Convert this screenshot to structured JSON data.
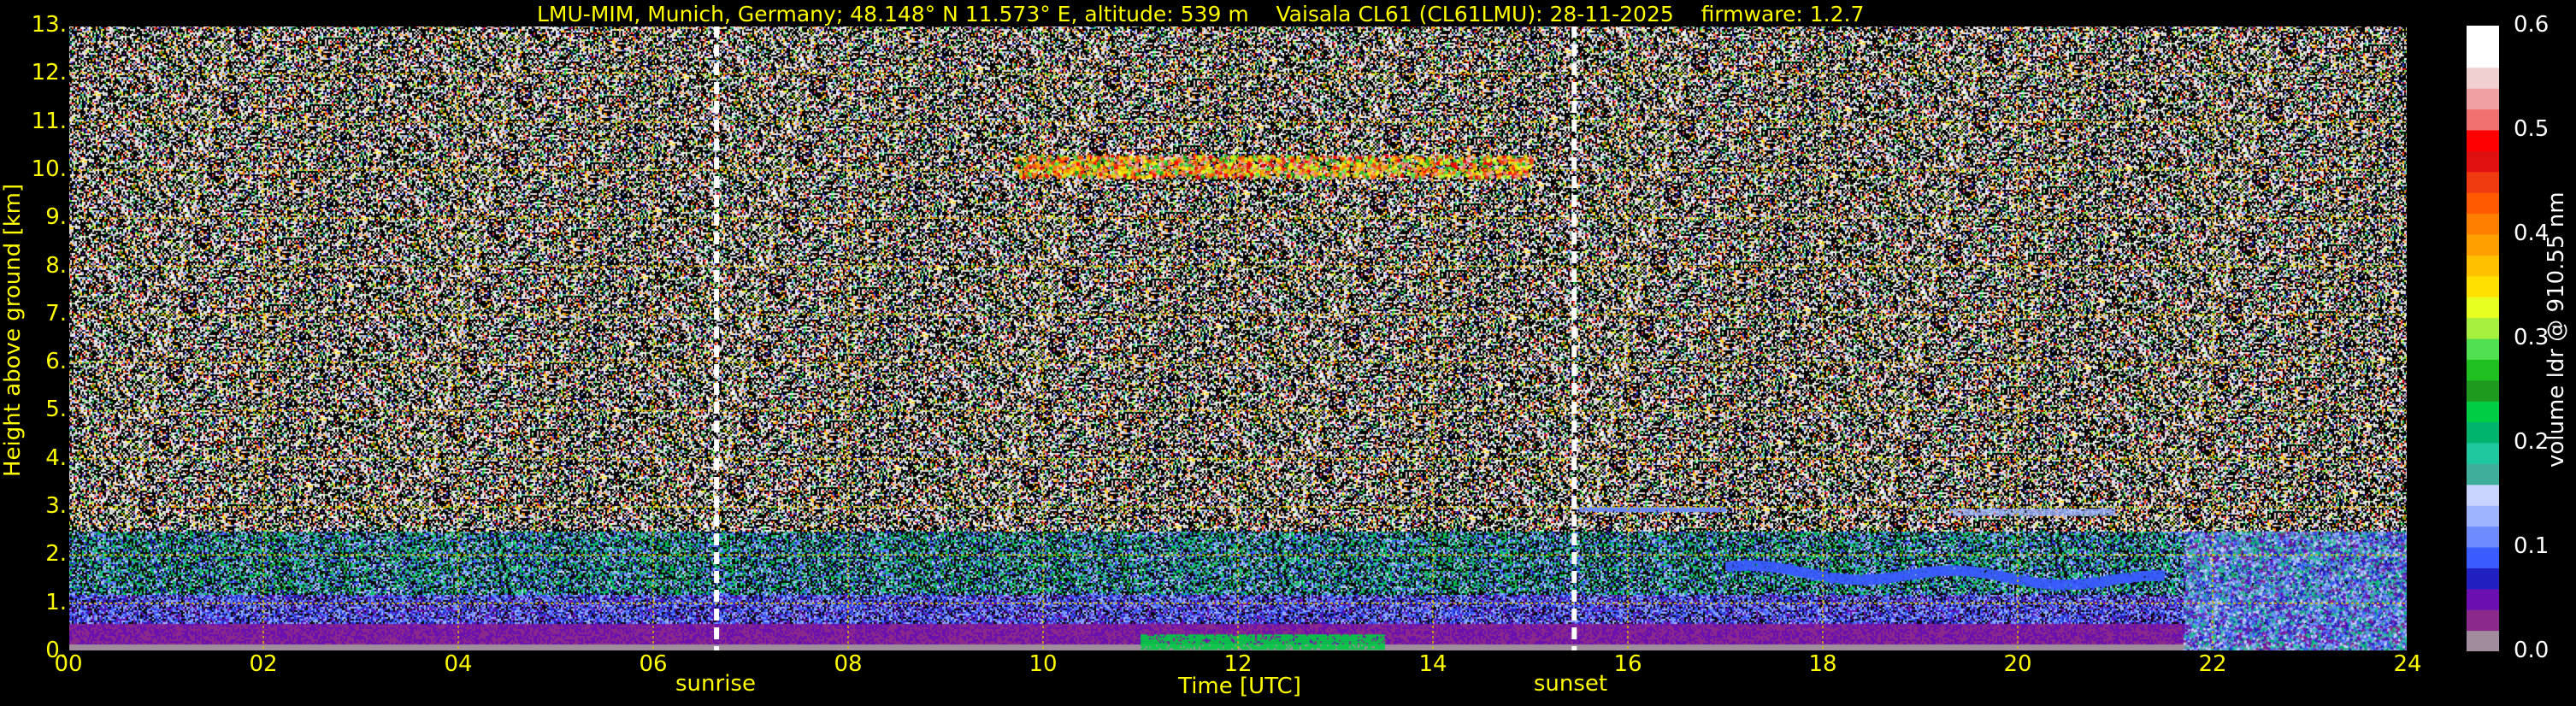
{
  "chart_data": {
    "type": "heatmap",
    "title": {
      "site": "LMU-MIM, Munich, Germany; 48.148° N 11.573° E, altitude: 539 m",
      "instrument": "Vaisala CL61 (CL61LMU): 28-11-2025",
      "firmware": "firmware: 1.2.7"
    },
    "xlabel": "Time [UTC]",
    "ylabel": "Height above ground [km]",
    "colorbar_label": "volume ldr @ 910.55 nm",
    "xlim": [
      0,
      24
    ],
    "ylim": [
      0,
      13
    ],
    "x_ticks": [
      "00",
      "02",
      "04",
      "06",
      "08",
      "10",
      "12",
      "14",
      "16",
      "18",
      "20",
      "22",
      "24"
    ],
    "y_ticks": [
      "0.",
      "1.",
      "2.",
      "3.",
      "4.",
      "5.",
      "6.",
      "7.",
      "8.",
      "9.",
      "10.",
      "11.",
      "12.",
      "13."
    ],
    "colorbar_ticks": [
      "0.0",
      "0.1",
      "0.2",
      "0.3",
      "0.4",
      "0.5",
      "0.6"
    ],
    "colorbar_range": [
      0.0,
      0.6
    ],
    "colorbar_colors": [
      "#a08c9c",
      "#8b2a8b",
      "#6a0fb0",
      "#2020c0",
      "#3a5cff",
      "#6f8cff",
      "#9fb4ff",
      "#c8d4ff",
      "#3fae9a",
      "#20c8a0",
      "#00b46e",
      "#00cc44",
      "#1e9a1e",
      "#20c020",
      "#50e050",
      "#a8f040",
      "#e6ff20",
      "#ffe000",
      "#ffc000",
      "#ffa000",
      "#ff7f00",
      "#ff5a00",
      "#f03a10",
      "#e01010",
      "#ff0000",
      "#f07070",
      "#f0a0a0",
      "#f0d0d0",
      "#ffffff",
      "#ffffff"
    ],
    "events": [
      {
        "label": "sunrise",
        "time": 6.65
      },
      {
        "label": "sunset",
        "time": 15.45
      }
    ],
    "grid": true,
    "features": [
      {
        "name": "cirrus",
        "t_start": 9.7,
        "t_end": 15.0,
        "height": 10.1,
        "ldr": 0.4
      },
      {
        "name": "boundary-layer",
        "t_start": 0,
        "t_end": 24,
        "height_top": 0.6,
        "ldr": 0.02
      },
      {
        "name": "surface-layer-green",
        "t_start": 11.0,
        "t_end": 13.5,
        "height_top": 0.35,
        "ldr": 0.22
      },
      {
        "name": "cloud-layer-low",
        "t_start": 17.0,
        "t_end": 21.5,
        "height": 1.7,
        "ldr": 0.08
      },
      {
        "name": "cloud-layer-3km",
        "t_start": 15.5,
        "t_end": 17.0,
        "height": 2.95,
        "ldr": 0.1
      },
      {
        "name": "cloud-layer-3km-b",
        "t_start": 19.3,
        "t_end": 21.0,
        "height": 2.9,
        "ldr": 0.12
      },
      {
        "name": "precipitation",
        "t_start": 21.7,
        "t_end": 24.0,
        "height_top": 2.5,
        "ldr": 0.12
      }
    ]
  }
}
